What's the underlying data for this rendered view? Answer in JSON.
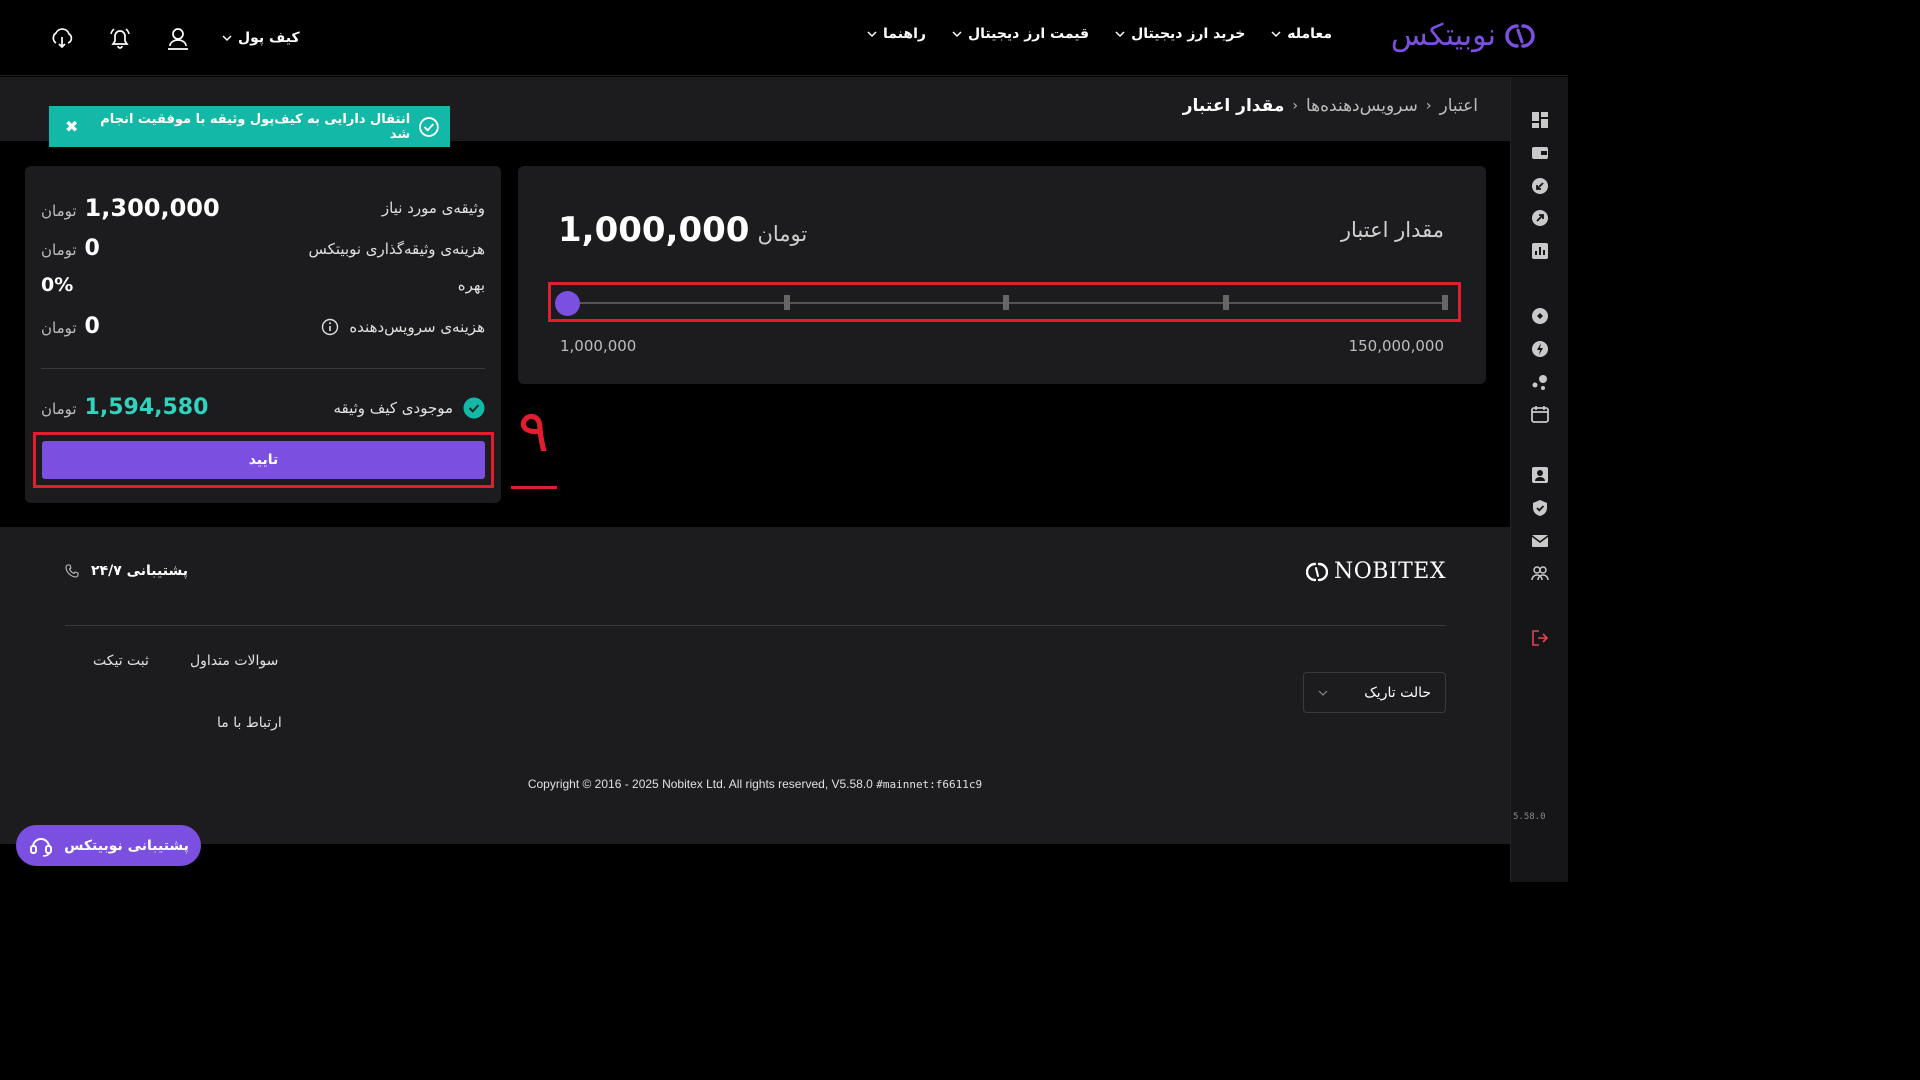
{
  "header": {
    "logo_text": "نوبیتکس",
    "nav": [
      "معامله",
      "خرید ارز دیجیتال",
      "قیمت ارز دیجیتال",
      "راهنما"
    ],
    "wallet_label": "کیف پول",
    "icons": [
      "download-icon",
      "bell-icon",
      "user-icon"
    ]
  },
  "breadcrumb": {
    "items": [
      "اعتبار",
      "سرویس‌دهنده‌ها"
    ],
    "current": "مقدار اعتبار"
  },
  "toast": {
    "message": "انتقال دارایی به کیف‌پول وثیقه با موفقیت انجام شد",
    "close": "✖"
  },
  "credit": {
    "title": "مقدار اعتبار",
    "value": "1,000,000",
    "unit": "تومان",
    "slider_min": "1,000,000",
    "slider_max": "150,000,000",
    "slider_fraction": 0
  },
  "summary": {
    "required_collateral_label": "وثیقه‌ی مورد نیاز",
    "required_collateral_value": "1,300,000",
    "collateral_fee_label": "هزینه‌ی وثیقه‌گذاری نوبیتکس",
    "collateral_fee_value": "0",
    "interest_label": "بهره",
    "interest_value": "0%",
    "service_fee_label": "هزینه‌ی سرویس‌دهنده",
    "service_fee_value": "0",
    "wallet_balance_label": "موجودی کیف وثیقه",
    "wallet_balance_value": "1,594,580",
    "unit": "تومان",
    "confirm_label": "تایید"
  },
  "annotation": {
    "step": "۹"
  },
  "footer": {
    "brand": "NOBITEX",
    "support": "پشتیبانی ۲۴/۷",
    "links": [
      "سوالات متداول",
      "ثبت تیکت",
      "ارتباط با ما"
    ],
    "theme_label": "حالت تاریک",
    "copyright": "Copyright © 2016 - 2025 Nobitex Ltd. All rights reserved, V5.58.0",
    "build_hash": "#mainnet:f6611c9"
  },
  "sidebar": {
    "version": "5.58.0"
  },
  "support_pill": {
    "label": "پشتیبانی نوبیتکس"
  },
  "colors": {
    "brand": "#7b4fe0",
    "success": "#14b8a6",
    "annotation": "#e11d2e"
  }
}
